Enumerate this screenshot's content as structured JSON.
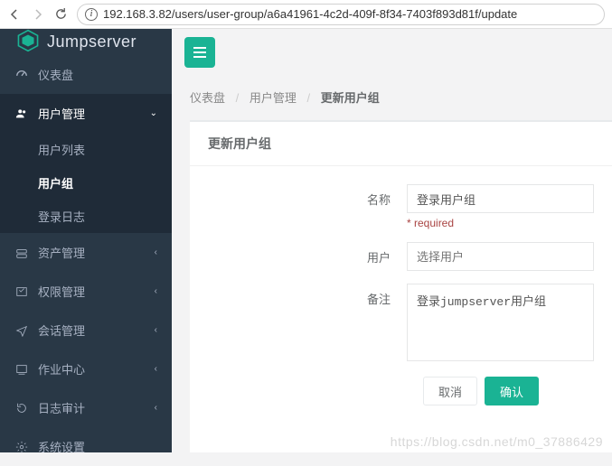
{
  "browser": {
    "url": "192.168.3.82/users/user-group/a6a41961-4c2d-409f-8f34-7403f893d81f/update"
  },
  "brand": {
    "name": "Jumpserver"
  },
  "sidebar": {
    "items": [
      {
        "icon": "dashboard-icon",
        "label": "仪表盘"
      },
      {
        "icon": "users-icon",
        "label": "用户管理",
        "open": true,
        "children": [
          {
            "label": "用户列表"
          },
          {
            "label": "用户组",
            "active": true
          },
          {
            "label": "登录日志"
          }
        ]
      },
      {
        "icon": "asset-icon",
        "label": "资产管理"
      },
      {
        "icon": "perm-icon",
        "label": "权限管理"
      },
      {
        "icon": "session-icon",
        "label": "会话管理"
      },
      {
        "icon": "job-icon",
        "label": "作业中心"
      },
      {
        "icon": "audit-icon",
        "label": "日志审计"
      },
      {
        "icon": "settings-icon",
        "label": "系统设置"
      }
    ]
  },
  "breadcrumb": {
    "items": [
      "仪表盘",
      "用户管理",
      "更新用户组"
    ]
  },
  "panel": {
    "title": "更新用户组"
  },
  "form": {
    "name_label": "名称",
    "name_value": "登录用户组",
    "name_hint": "* required",
    "user_label": "用户",
    "user_placeholder": "选择用户",
    "comment_label": "备注",
    "comment_value": "登录jumpserver用户组",
    "cancel": "取消",
    "submit": "确认"
  },
  "watermark": "https://blog.csdn.net/m0_37886429"
}
